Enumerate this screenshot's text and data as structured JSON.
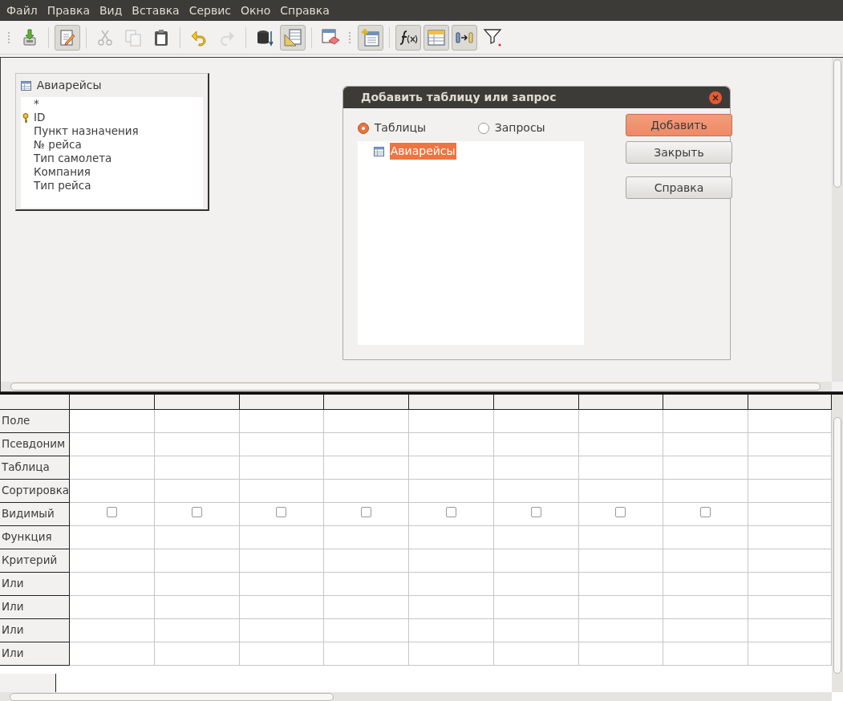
{
  "menu": [
    "Файл",
    "Правка",
    "Вид",
    "Вставка",
    "Сервис",
    "Окно",
    "Справка"
  ],
  "toolbar": [
    {
      "kind": "grip"
    },
    {
      "kind": "save",
      "pressed": false,
      "disabled": false
    },
    {
      "kind": "sep"
    },
    {
      "kind": "edit",
      "pressed": true,
      "disabled": false
    },
    {
      "kind": "sep"
    },
    {
      "kind": "cut",
      "pressed": false,
      "disabled": true
    },
    {
      "kind": "copy",
      "pressed": false,
      "disabled": true
    },
    {
      "kind": "paste",
      "pressed": false,
      "disabled": false
    },
    {
      "kind": "sep"
    },
    {
      "kind": "undo",
      "pressed": false,
      "disabled": false
    },
    {
      "kind": "redo",
      "pressed": false,
      "disabled": true
    },
    {
      "kind": "sep"
    },
    {
      "kind": "run",
      "pressed": false,
      "disabled": false
    },
    {
      "kind": "design",
      "pressed": true,
      "disabled": false
    },
    {
      "kind": "sep"
    },
    {
      "kind": "clear",
      "pressed": false,
      "disabled": false
    },
    {
      "kind": "grip"
    },
    {
      "kind": "addtable",
      "pressed": true,
      "disabled": false
    },
    {
      "kind": "sep"
    },
    {
      "kind": "function",
      "pressed": true,
      "disabled": false
    },
    {
      "kind": "tablename",
      "pressed": true,
      "disabled": false
    },
    {
      "kind": "alias",
      "pressed": true,
      "disabled": false
    },
    {
      "kind": "distinct",
      "pressed": false,
      "disabled": false
    }
  ],
  "table_window": {
    "title": "Авиарейсы",
    "fields": [
      {
        "name": "*",
        "key": false
      },
      {
        "name": "ID",
        "key": true
      },
      {
        "name": "Пункт назначения",
        "key": false
      },
      {
        "name": "№ рейса",
        "key": false
      },
      {
        "name": "Тип самолета",
        "key": false
      },
      {
        "name": "Компания",
        "key": false
      },
      {
        "name": "Тип рейса",
        "key": false
      }
    ]
  },
  "dialog": {
    "title": "Добавить таблицу или запрос",
    "options": [
      {
        "label": "Таблицы",
        "selected": true
      },
      {
        "label": "Запросы",
        "selected": false
      }
    ],
    "items": [
      {
        "label": "Авиарейсы",
        "selected": true
      }
    ],
    "buttons": [
      {
        "label": "Добавить",
        "default": true
      },
      {
        "label": "Закрыть",
        "default": false
      },
      {
        "label": "Справка",
        "default": false
      }
    ]
  },
  "grid": {
    "rows": [
      {
        "label": "Поле",
        "kind": "text"
      },
      {
        "label": "Псевдоним",
        "kind": "text"
      },
      {
        "label": "Таблица",
        "kind": "text"
      },
      {
        "label": "Сортировка",
        "kind": "text"
      },
      {
        "label": "Видимый",
        "kind": "checkbox",
        "checks": [
          false,
          false,
          false,
          false,
          false,
          false,
          false,
          false
        ]
      },
      {
        "label": "Функция",
        "kind": "text"
      },
      {
        "label": "Критерий",
        "kind": "text"
      },
      {
        "label": "Или",
        "kind": "text"
      },
      {
        "label": "Или",
        "kind": "text"
      },
      {
        "label": "Или",
        "kind": "text"
      },
      {
        "label": "Или",
        "kind": "text"
      }
    ]
  }
}
